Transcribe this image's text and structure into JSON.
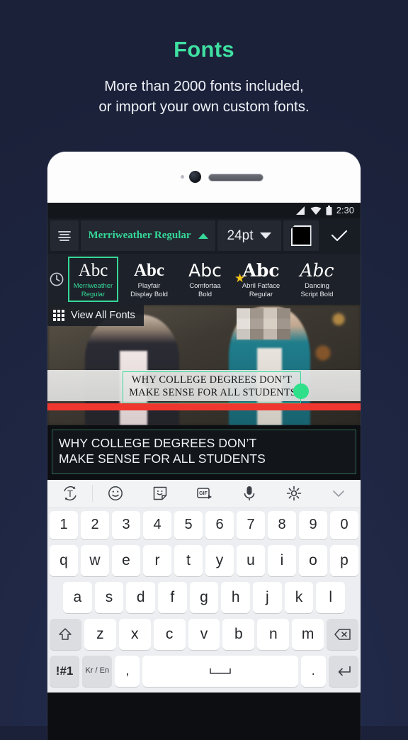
{
  "promo": {
    "title": "Fonts",
    "subtitle_line1": "More than 2000 fonts included,",
    "subtitle_line2": "or import your own custom fonts."
  },
  "colors": {
    "accent_green": "#3fe0a2",
    "toolbar_green": "#35d898",
    "handle_green": "#2ee08a",
    "progress_red": "#f0372f",
    "background_navy": "#1e2642",
    "star_yellow": "#f5c518"
  },
  "statusbar": {
    "time": "2:30",
    "icons": [
      "signal-icon",
      "wifi-icon",
      "battery-icon"
    ]
  },
  "font_toolbar": {
    "align_icon": "text-align-icon",
    "font_name": "Merriweather Regular",
    "font_name_caret": "caret-up-icon",
    "font_size": "24pt",
    "font_size_caret": "caret-down-icon",
    "color_swatch": "color-swatch-black",
    "confirm_icon": "checkmark-icon"
  },
  "font_carousel": {
    "recent_icon": "clock-icon",
    "sample_text": "Abc",
    "items": [
      {
        "label_line1": "Merriweather",
        "label_line2": "Regular",
        "selected": true,
        "starred": false
      },
      {
        "label_line1": "Playfair",
        "label_line2": "Display Bold",
        "selected": false,
        "starred": false
      },
      {
        "label_line1": "Comfortaa",
        "label_line2": "Bold",
        "selected": false,
        "starred": false
      },
      {
        "label_line1": "Abril Fatface",
        "label_line2": "Regular",
        "selected": false,
        "starred": true
      },
      {
        "label_line1": "Dancing",
        "label_line2": "Script Bold",
        "selected": false,
        "starred": false
      }
    ]
  },
  "preview": {
    "view_all_fonts_label": "View All Fonts",
    "view_all_fonts_icon": "grid-icon",
    "caption_line1": "WHY COLLEGE DEGREES DON’T",
    "caption_line2": "MAKE SENSE FOR ALL STUDENTS",
    "drag_handle": "resize-handle",
    "progress_bar": "timeline-progress"
  },
  "editor": {
    "text_line1": "WHY COLLEGE DEGREES DON’T",
    "text_line2": "MAKE SENSE FOR ALL STUDENTS"
  },
  "keyboard": {
    "toolbar_icons": [
      "translate-icon",
      "emoji-icon",
      "sticker-icon",
      "gif-icon",
      "microphone-icon",
      "settings-icon",
      "chevron-down-icon"
    ],
    "row_numbers": [
      "1",
      "2",
      "3",
      "4",
      "5",
      "6",
      "7",
      "8",
      "9",
      "0"
    ],
    "row_top": [
      "q",
      "w",
      "e",
      "r",
      "t",
      "y",
      "u",
      "i",
      "o",
      "p"
    ],
    "row_home": [
      "a",
      "s",
      "d",
      "f",
      "g",
      "h",
      "j",
      "k",
      "l"
    ],
    "row_bottom": [
      "z",
      "x",
      "c",
      "v",
      "b",
      "n",
      "m"
    ],
    "shift_key": "shift-icon",
    "backspace_key": "backspace-icon",
    "symbols_key": "!#1",
    "language_key_top": "Kr",
    "language_key_bottom": "En",
    "comma_key": ",",
    "space_key": "space-icon",
    "period_key": ".",
    "enter_key": "enter-icon"
  }
}
